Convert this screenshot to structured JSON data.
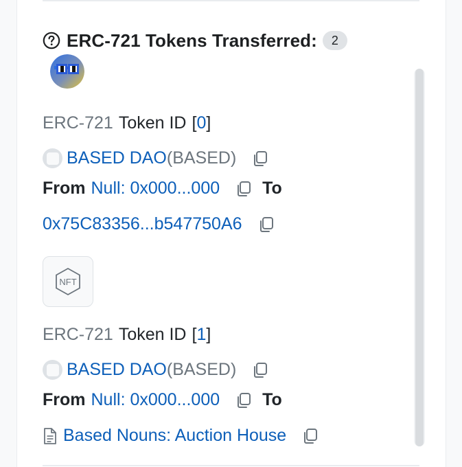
{
  "header": {
    "title": "ERC-721 Tokens Transferred:",
    "count": "2"
  },
  "transfers": [
    {
      "standard": "ERC-721",
      "token_id_label": "Token ID",
      "bracket_open": "[",
      "token_id": "0",
      "bracket_close": "]",
      "token_name": "BASED DAO",
      "token_symbol": "(BASED)",
      "from_label": "From",
      "from_address": "Null: 0x000...000",
      "to_label": "To",
      "to_address": "0x75C83356...b547750A6"
    },
    {
      "standard": "ERC-721",
      "token_id_label": "Token ID",
      "bracket_open": "[",
      "token_id": "1",
      "bracket_close": "]",
      "token_name": "BASED DAO",
      "token_symbol": "(BASED)",
      "from_label": "From",
      "from_address": "Null: 0x000...000",
      "to_label": "To",
      "to_address": "Based Nouns: Auction House"
    }
  ],
  "nft_placeholder": {
    "label": "NFT"
  },
  "colors": {
    "link": "#0d5fb9",
    "muted": "#6c757d",
    "badge_bg": "#e0e3e6"
  },
  "icons": {
    "help": "question-circle-icon",
    "copy": "copy-icon",
    "contract": "document-icon",
    "token": "token-coin-icon",
    "nft": "nft-hexagon-icon"
  }
}
